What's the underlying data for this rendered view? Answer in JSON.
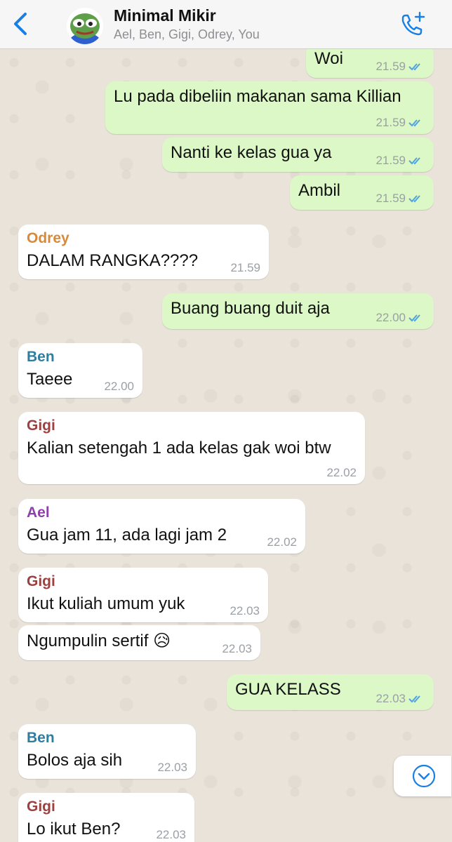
{
  "header": {
    "title": "Minimal Mikir",
    "members": "Ael, Ben, Gigi, Odrey, You"
  },
  "colors": {
    "accent": "#1a7fe5",
    "outgoing_bubble": "#dcf8c6",
    "incoming_bubble": "#ffffff",
    "read_ticks": "#4fa3e0",
    "sender_odrey": "#d88a3a",
    "sender_ben": "#2f7ea0",
    "sender_gigi": "#9c4040",
    "sender_ael": "#8e3fa8"
  },
  "messages": [
    {
      "dir": "out",
      "text": "Woi",
      "time": "21.59",
      "read": true
    },
    {
      "dir": "out",
      "text": "Lu pada dibeliin makanan sama Killian",
      "time": "21.59",
      "read": true
    },
    {
      "dir": "out",
      "text": "Nanti ke kelas gua ya",
      "time": "21.59",
      "read": true
    },
    {
      "dir": "out",
      "text": "Ambil",
      "time": "21.59",
      "read": true
    },
    {
      "dir": "in",
      "sender": "Odrey",
      "text": "DALAM RANGKA????",
      "time": "21.59"
    },
    {
      "dir": "out",
      "text": "Buang buang duit aja",
      "time": "22.00",
      "read": true
    },
    {
      "dir": "in",
      "sender": "Ben",
      "text": "Taeee",
      "time": "22.00"
    },
    {
      "dir": "in",
      "sender": "Gigi",
      "text": "Kalian setengah 1 ada kelas gak woi btw",
      "time": "22.02"
    },
    {
      "dir": "in",
      "sender": "Ael",
      "text": "Gua jam 11, ada lagi jam 2",
      "time": "22.02"
    },
    {
      "dir": "in",
      "sender": "Gigi",
      "text": "Ikut kuliah umum yuk",
      "time": "22.03"
    },
    {
      "dir": "in",
      "text": "Ngumpulin sertif 😥",
      "time": "22.03"
    },
    {
      "dir": "out",
      "text": "GUA KELASS",
      "time": "22.03",
      "read": true
    },
    {
      "dir": "in",
      "sender": "Ben",
      "text": "Bolos aja sih",
      "time": "22.03"
    },
    {
      "dir": "in",
      "sender": "Gigi",
      "text": "Lo ikut Ben?",
      "time": "22.03"
    }
  ],
  "icons": {
    "back": "chevron-left-icon",
    "call": "add-call-icon",
    "scroll": "chevron-down-icon",
    "read": "double-check-icon"
  }
}
